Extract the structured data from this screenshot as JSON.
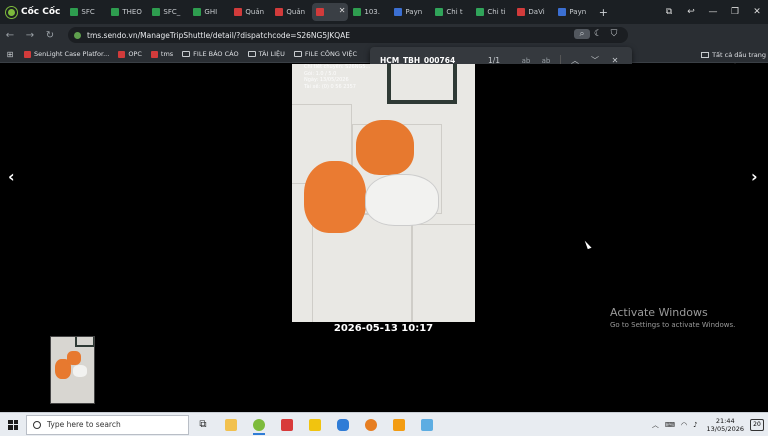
{
  "browser": {
    "brand": "Cốc Cốc",
    "tabs": [
      {
        "label": "SFC",
        "color": "#2e9d4f"
      },
      {
        "label": "THEO",
        "color": "#2e9d4f"
      },
      {
        "label": "SFC_",
        "color": "#2e9d4f"
      },
      {
        "label": "GHI",
        "color": "#2e9d4f"
      },
      {
        "label": "Quản",
        "color": "#d23b3b"
      },
      {
        "label": "Quản",
        "color": "#d23b3b"
      },
      {
        "label": "",
        "color": "#d23b3b",
        "active": true
      },
      {
        "label": "103.",
        "color": "#2e9d4f"
      },
      {
        "label": "Payn",
        "color": "#3b6fd2"
      },
      {
        "label": "Chi t",
        "color": "#30a45a"
      },
      {
        "label": "Chi ti",
        "color": "#30a45a"
      },
      {
        "label": "DaVi",
        "color": "#d23b3b"
      },
      {
        "label": "Payn",
        "color": "#3b6fd2"
      }
    ],
    "new_tab": "+",
    "url": "tms.sendo.vn/ManageTripShuttle/detail/?dispatchcode=S26NG5JKQAE"
  },
  "bookmarks": [
    {
      "label": "SenLight Case Platfor...",
      "type": "site",
      "color": "#d23b3b"
    },
    {
      "label": "OPC",
      "type": "site",
      "color": "#d23b3b"
    },
    {
      "label": "tms",
      "type": "site",
      "color": "#d23b3b"
    },
    {
      "label": "FILE BÁO CÁO",
      "type": "folder"
    },
    {
      "label": "TÀI LIỆU",
      "type": "folder"
    },
    {
      "label": "FILE CÔNG VIỆC",
      "type": "folder"
    }
  ],
  "bookmarks_all": "Tất cả dấu trang",
  "find": {
    "query": "HCM_TBH_000764",
    "count": "1/1",
    "opt1": "ab",
    "opt2": "ab"
  },
  "viewer": {
    "stamp_lines": [
      "Chi tiết chuyến: S26NG5...",
      "Gói: 1.0 / 5.0",
      "Ngày: 13/05/2026",
      "Tài xế: (0) 0 56 2357"
    ],
    "caption": "2026-05-13 10:17",
    "prev": "‹",
    "next": "›"
  },
  "watermark": {
    "title": "Activate Windows",
    "subtitle": "Go to Settings to activate Windows."
  },
  "taskbar": {
    "search_placeholder": "Type here to search",
    "time": "21:44",
    "date": "13/05/2026",
    "notif_count": "20"
  }
}
